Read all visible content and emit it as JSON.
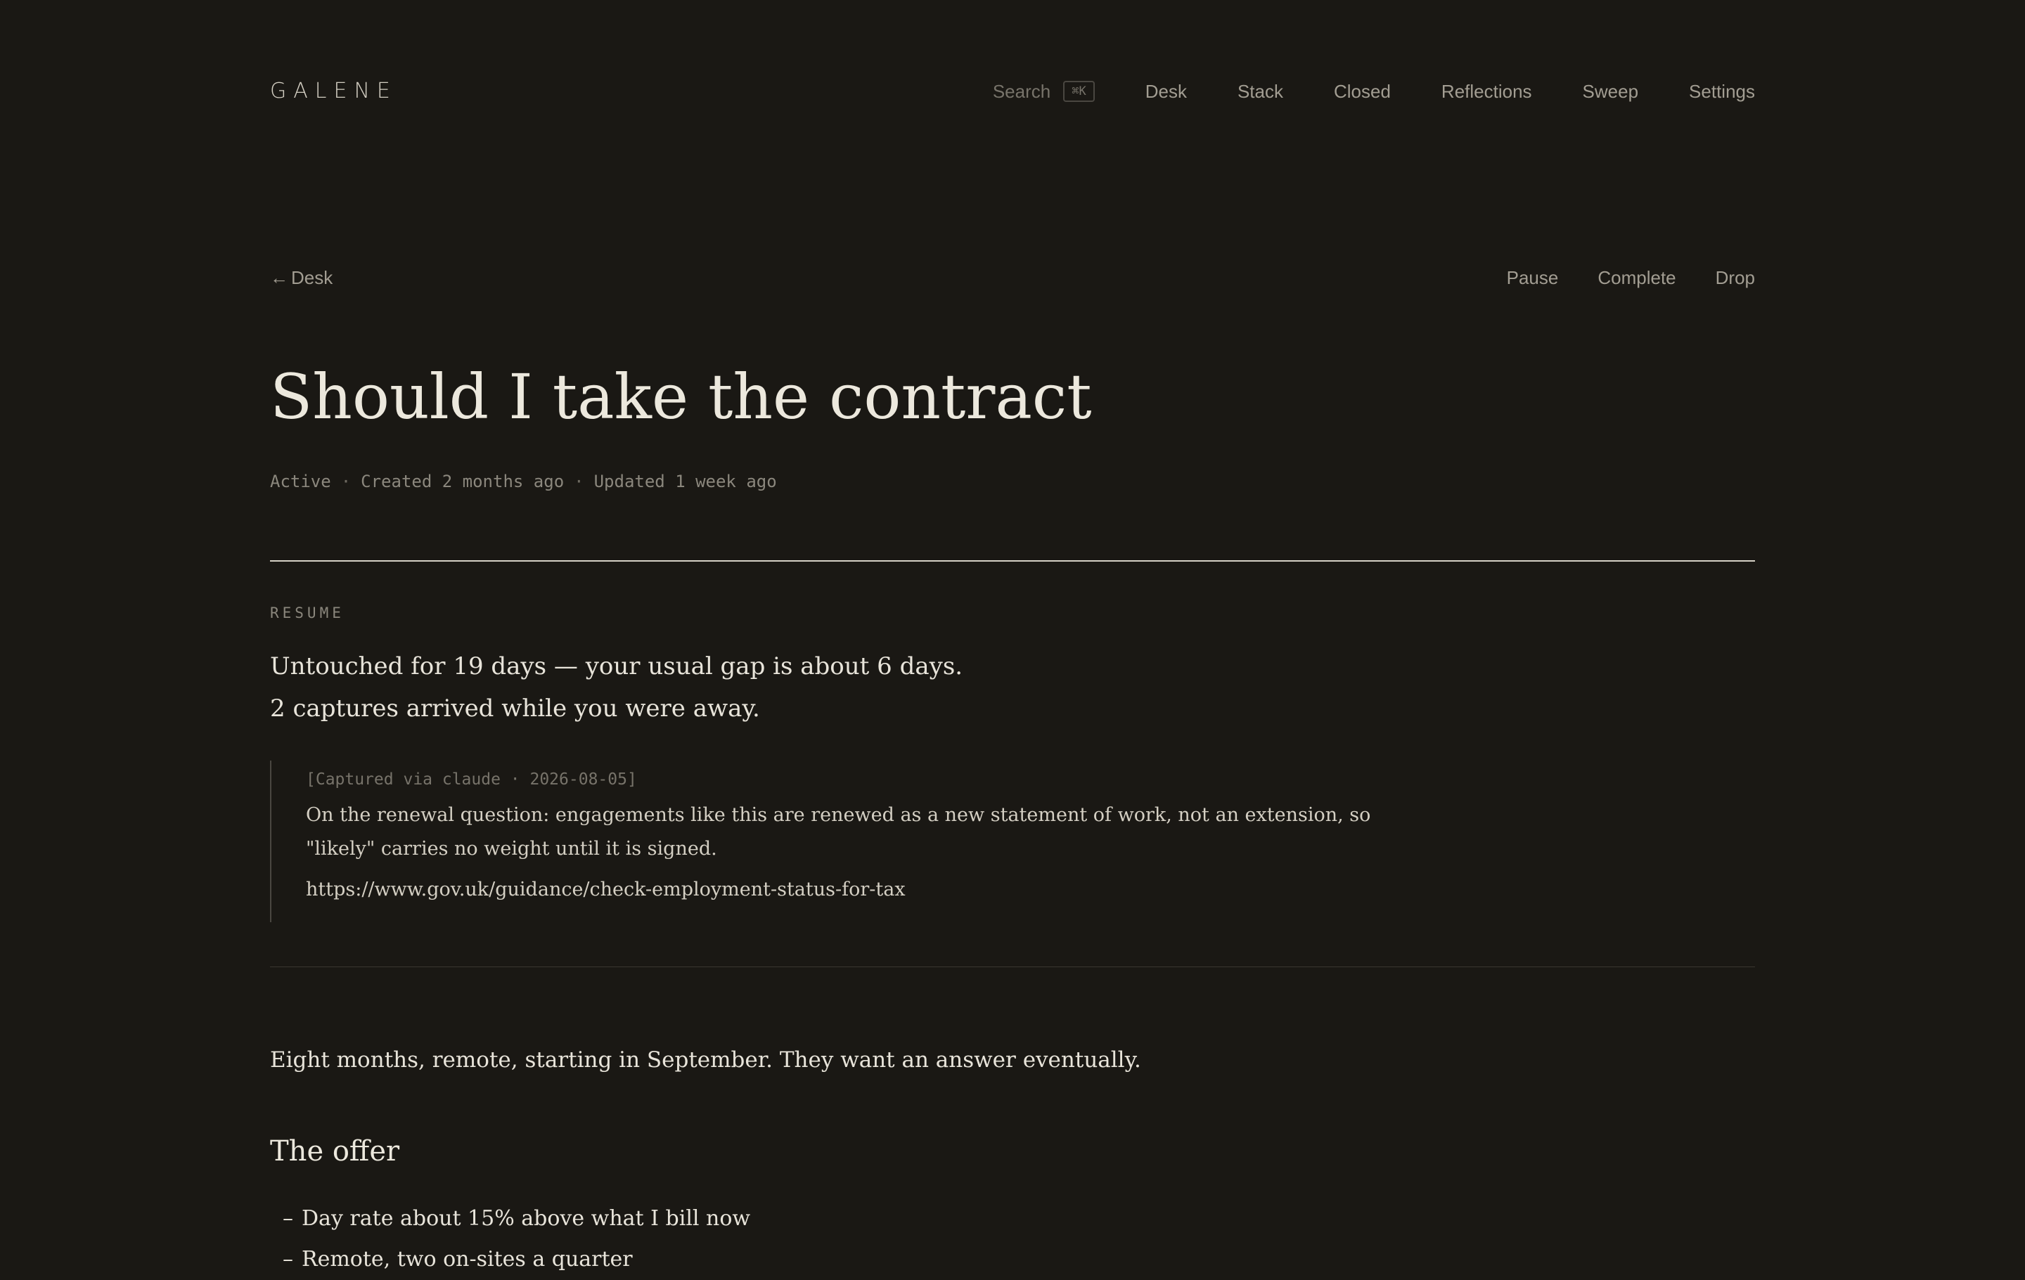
{
  "header": {
    "brand": "GALENE",
    "search_label": "Search",
    "search_shortcut": "⌘K",
    "nav": [
      "Desk",
      "Stack",
      "Closed",
      "Reflections",
      "Sweep",
      "Settings"
    ]
  },
  "toolbar": {
    "back_arrow": "←",
    "back_label": "Desk",
    "actions": [
      "Pause",
      "Complete",
      "Drop"
    ]
  },
  "decision": {
    "title": "Should I take the contract",
    "status": "Active",
    "created": "Created 2 months ago",
    "updated": "Updated 1 week ago",
    "separator": "·"
  },
  "resume": {
    "label": "RESUME",
    "lines": [
      "Untouched for 19 days — your usual gap is about 6 days.",
      "2 captures arrived while you were away."
    ],
    "capture": {
      "tag": "[Captured via claude · 2026-08-05]",
      "text": "On the renewal question: engagements like this are renewed as a new statement of work, not an extension, so \"likely\" carries no weight until it is signed.",
      "link": "https://www.gov.uk/guidance/check-employment-status-for-tax"
    }
  },
  "body": {
    "intro": "Eight months, remote, starting in September. They want an answer eventually.",
    "section_title": "The offer",
    "bullet": "–",
    "items": [
      "Day rate about 15% above what I bill now",
      "Remote, two on-sites a quarter"
    ]
  },
  "colors": {
    "background": "#1a1814",
    "text": "#e8e4da",
    "muted": "#8b877d",
    "rule": "#d6d1c6"
  }
}
